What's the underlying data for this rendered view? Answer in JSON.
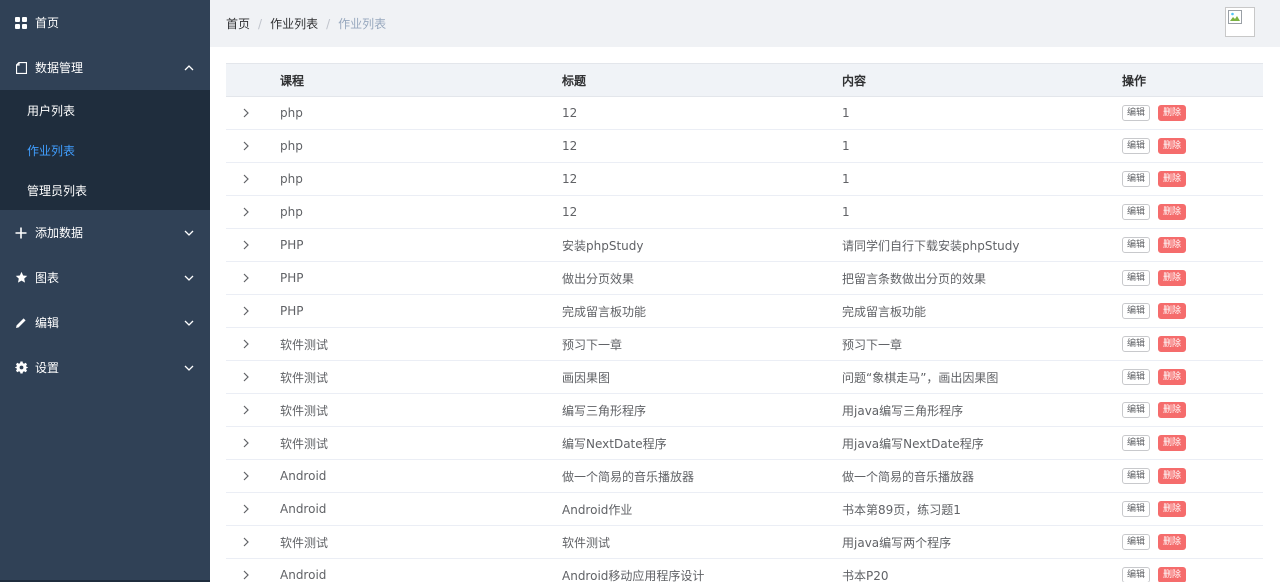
{
  "sidebar": {
    "home": {
      "label": "首页",
      "icon": "grid-icon"
    },
    "data_mgmt": {
      "label": "数据管理",
      "icon": "document-icon",
      "expanded": true,
      "items": [
        {
          "label": "用户列表",
          "active": false
        },
        {
          "label": "作业列表",
          "active": true
        },
        {
          "label": "管理员列表",
          "active": false
        }
      ]
    },
    "add_data": {
      "label": "添加数据",
      "icon": "plus-icon"
    },
    "charts": {
      "label": "图表",
      "icon": "star-icon"
    },
    "edit": {
      "label": "编辑",
      "icon": "pencil-icon"
    },
    "settings": {
      "label": "设置",
      "icon": "gear-icon"
    }
  },
  "breadcrumb": [
    "首页",
    "作业列表",
    "作业列表"
  ],
  "breadcrumb_sep": "/",
  "table": {
    "headers": {
      "course": "课程",
      "title": "标题",
      "content": "内容",
      "actions": "操作"
    },
    "edit_label": "编辑",
    "delete_label": "删除",
    "rows": [
      {
        "course": "php",
        "title": "12",
        "content": "1"
      },
      {
        "course": "php",
        "title": "12",
        "content": "1"
      },
      {
        "course": "php",
        "title": "12",
        "content": "1"
      },
      {
        "course": "php",
        "title": "12",
        "content": "1"
      },
      {
        "course": "PHP",
        "title": "安装phpStudy",
        "content": "请同学们自行下载安装phpStudy"
      },
      {
        "course": "PHP",
        "title": "做出分页效果",
        "content": "把留言条数做出分页的效果"
      },
      {
        "course": "PHP",
        "title": "完成留言板功能",
        "content": "完成留言板功能"
      },
      {
        "course": "软件测试",
        "title": "预习下一章",
        "content": "预习下一章"
      },
      {
        "course": "软件测试",
        "title": "画因果图",
        "content": "问题“象棋走马”，画出因果图"
      },
      {
        "course": "软件测试",
        "title": "编写三角形程序",
        "content": "用java编写三角形程序"
      },
      {
        "course": "软件测试",
        "title": "编写NextDate程序",
        "content": "用java编写NextDate程序"
      },
      {
        "course": "Android",
        "title": "做一个简易的音乐播放器",
        "content": "做一个简易的音乐播放器"
      },
      {
        "course": "Android",
        "title": "Android作业",
        "content": "书本第89页，练习题1"
      },
      {
        "course": "软件测试",
        "title": "软件测试",
        "content": "用java编写两个程序"
      },
      {
        "course": "Android",
        "title": "Android移动应用程序设计",
        "content": "书本P20"
      }
    ]
  },
  "colors": {
    "sidebar_bg": "#304156",
    "submenu_bg": "#1f2d3d",
    "active_link": "#409eff",
    "danger": "#f56c6c"
  }
}
